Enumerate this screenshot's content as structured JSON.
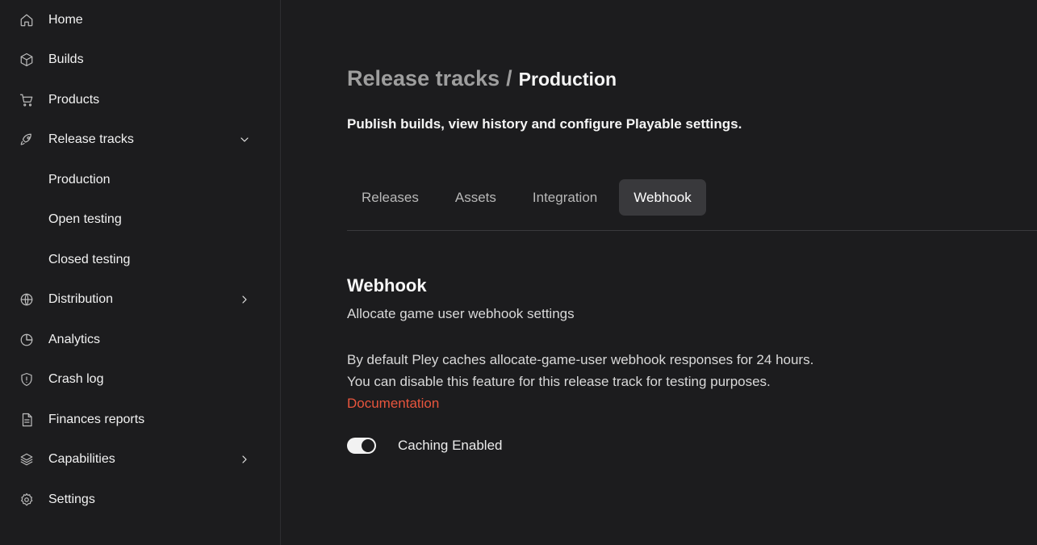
{
  "sidebar": {
    "items": [
      {
        "label": "Home",
        "icon": "home-icon"
      },
      {
        "label": "Builds",
        "icon": "box-icon"
      },
      {
        "label": "Products",
        "icon": "cart-icon"
      },
      {
        "label": "Release tracks",
        "icon": "rocket-icon",
        "expanded": true,
        "children": [
          {
            "label": "Production"
          },
          {
            "label": "Open testing"
          },
          {
            "label": "Closed testing"
          }
        ]
      },
      {
        "label": "Distribution",
        "icon": "globe-icon"
      },
      {
        "label": "Analytics",
        "icon": "pie-chart-icon"
      },
      {
        "label": "Crash log",
        "icon": "shield-alert-icon"
      },
      {
        "label": "Finances reports",
        "icon": "document-icon"
      },
      {
        "label": "Capabilities",
        "icon": "layers-icon"
      },
      {
        "label": "Settings",
        "icon": "gear-icon"
      }
    ]
  },
  "header": {
    "breadcrumb_parent": "Release tracks",
    "breadcrumb_separator": "/",
    "breadcrumb_current": "Production",
    "subtitle": "Publish builds, view history and configure Playable settings."
  },
  "tabs": [
    {
      "label": "Releases",
      "active": false
    },
    {
      "label": "Assets",
      "active": false
    },
    {
      "label": "Integration",
      "active": false
    },
    {
      "label": "Webhook",
      "active": true
    }
  ],
  "webhook": {
    "title": "Webhook",
    "subtitle": "Allocate game user webhook settings",
    "line1": "By default Pley caches allocate-game-user webhook responses for 24 hours.",
    "line2": "You can disable this feature for this release track for testing purposes.",
    "doc_link": "Documentation",
    "toggle_label": "Caching Enabled",
    "toggle_on": true
  },
  "colors": {
    "background": "#1c1c1e",
    "accent_link": "#e8553d",
    "active_tab": "#39393c"
  }
}
